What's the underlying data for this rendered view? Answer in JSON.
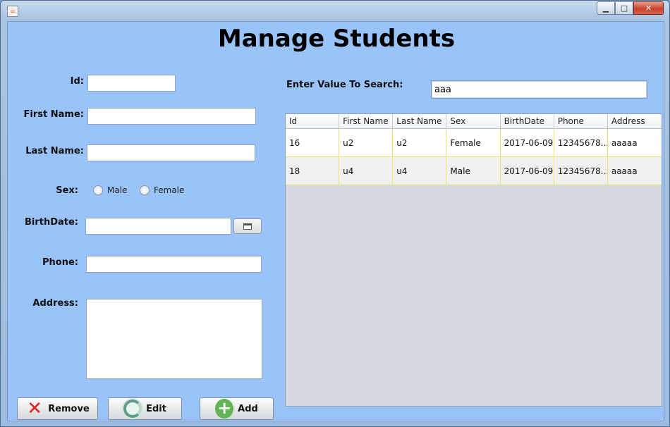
{
  "window": {
    "title": ""
  },
  "title": "Manage Students",
  "form": {
    "id_label": "Id:",
    "first_name_label": "First Name:",
    "last_name_label": "Last Name:",
    "sex_label": "Sex:",
    "sex_options": [
      "Male",
      "Female"
    ],
    "birthdate_label": "BirthDate:",
    "phone_label": "Phone:",
    "address_label": "Address:",
    "id_value": "",
    "first_name_value": "",
    "last_name_value": "",
    "birthdate_value": "",
    "phone_value": ""
  },
  "search": {
    "label": "Enter Value To Search:",
    "value": "aaa"
  },
  "table": {
    "columns": [
      "Id",
      "First Name",
      "Last Name",
      "Sex",
      "BirthDate",
      "Phone",
      "Address"
    ],
    "rows": [
      [
        "16",
        "u2",
        "u2",
        "Female",
        "2017-06-09",
        "12345678...",
        "aaaaa"
      ],
      [
        "18",
        "u4",
        "u4",
        "Male",
        "2017-06-09",
        "12345678...",
        "aaaaa"
      ]
    ]
  },
  "buttons": {
    "remove": "Remove",
    "edit": "Edit",
    "add": "Add"
  },
  "colors": {
    "panel": "#99c3f9",
    "row_grid": "#e9e27a"
  },
  "icons": [
    "java-app-icon",
    "minimize-icon",
    "maximize-icon",
    "close-icon",
    "calendar-icon",
    "remove-x-icon",
    "refresh-icon",
    "add-plus-icon"
  ]
}
